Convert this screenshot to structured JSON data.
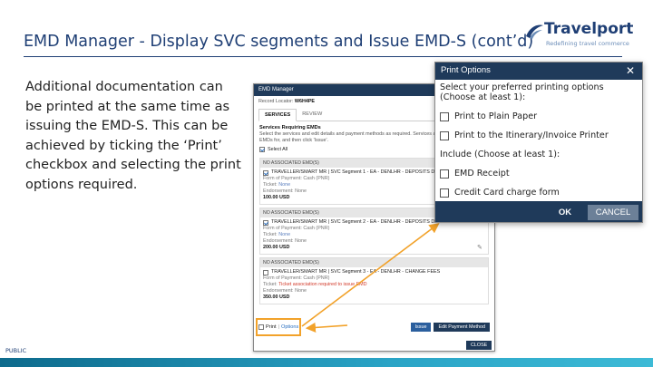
{
  "slide": {
    "title": "EMD Manager - Display SVC segments and Issue EMD-S (cont’d)",
    "body": "Additional documentation can be printed at the same time as issuing the EMD-S. This can be achieved by ticking the ‘Print’ checkbox and selecting the print options required.",
    "footer_label": "PUBLIC"
  },
  "logo": {
    "name": "Travelport",
    "tagline": "Redefining travel commerce"
  },
  "emd_manager": {
    "title": "EMD Manager",
    "record_locator_label": "Record Locator:",
    "record_locator_value": "W6H4PE",
    "tabs": [
      {
        "label": "SERVICES",
        "active": true
      },
      {
        "label": "REVIEW",
        "active": false
      }
    ],
    "section_title": "Services Requiring EMDs",
    "description": "Select the services and edit details and payment methods as required. Services are already to have EMDs for, and then click 'Issue'.",
    "select_all": "Select All",
    "segments": [
      {
        "header": "NO ASSOCIATED EMD(S)",
        "checked": true,
        "line": "TRAVELLER/SMART MR | SVC Segment 1 - EA - DENLHR - DEPOSITS DO",
        "fop_label": "Form of Payment: Cash (PNR)",
        "ticket_label": "Ticket:",
        "ticket_value": "None",
        "endorsement_label": "Endorsement:",
        "endorsement_value": "None",
        "amount": "100.00 USD"
      },
      {
        "header": "NO ASSOCIATED EMD(S)",
        "checked": true,
        "line": "TRAVELLER/SMART MR | SVC Segment 2 - EA - DENLHR - DEPOSITS DOWN PAYMENTS",
        "fop_label": "Form of Payment: Cash (PNR)",
        "ticket_label": "Ticket:",
        "ticket_value": "None",
        "endorsement_label": "Endorsement:",
        "endorsement_value": "None",
        "amount": "200.00 USD"
      },
      {
        "header": "NO ASSOCIATED EMD(S)",
        "checked": false,
        "line": "TRAVELLER/SMART MR | SVC Segment 3 - EA - DENLHR - CHANGE FEES",
        "fop_label": "Form of Payment: Cash (PNR)",
        "ticket_label": "Ticket:",
        "ticket_value": "Ticket association required to issue EMD",
        "endorsement_label": "Endorsement:",
        "endorsement_value": "None",
        "amount": "350.00 USD"
      }
    ],
    "print_label": "Print",
    "options_label": "Options",
    "issue_button": "Issue",
    "edit_payment_button": "Edit Payment Method",
    "close_button": "CLOSE"
  },
  "print_options": {
    "title": "Print Options",
    "close_glyph": "✕",
    "instruction_line1": "Select your preferred printing options",
    "instruction_line2": "(Choose at least 1):",
    "options": [
      {
        "label": "Print to Plain Paper",
        "checked": false
      },
      {
        "label": "Print to the Itinerary/Invoice Printer",
        "checked": false
      }
    ],
    "include_label": "Include (Choose at least 1):",
    "include_options": [
      {
        "label": "EMD Receipt",
        "checked": false
      },
      {
        "label": "Credit Card charge form",
        "checked": false
      }
    ],
    "ok_button": "OK",
    "cancel_button": "CANCEL"
  },
  "colors": {
    "title": "#1f3f75",
    "dialog_header": "#1f3a5a",
    "highlight": "#f2a22a",
    "footer_bar": "#2aa4c6"
  }
}
